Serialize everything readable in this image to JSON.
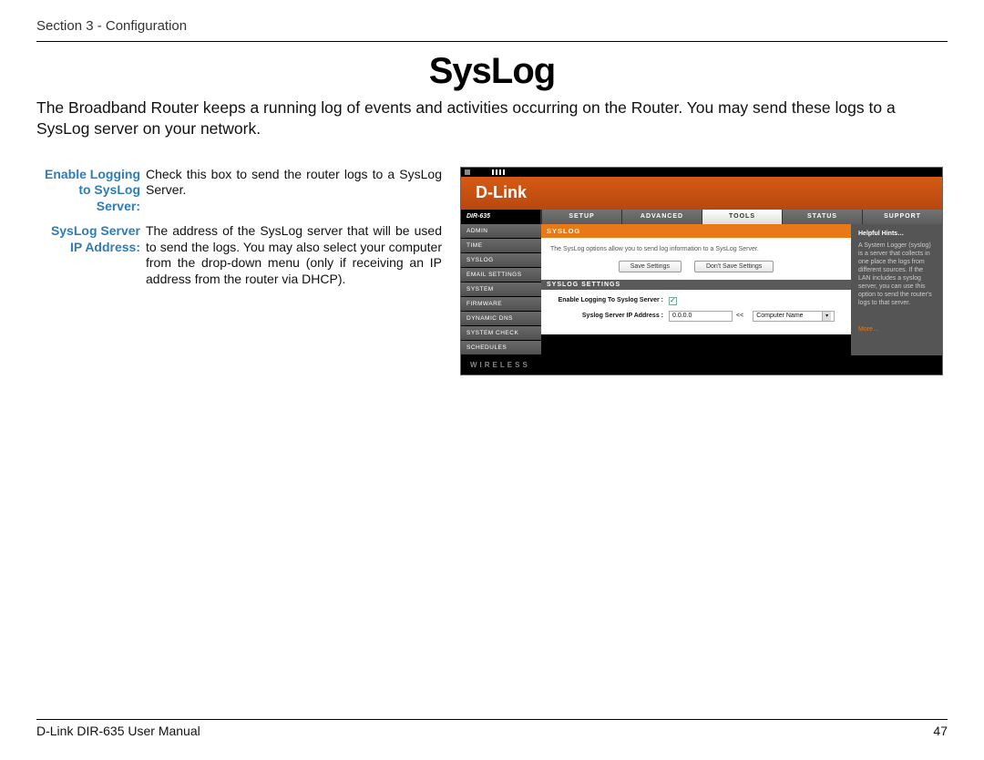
{
  "header": {
    "section": "Section 3 - Configuration"
  },
  "title": "SysLog",
  "intro": "The Broadband Router keeps a running log of events and activities occurring on the Router. You may send these logs to a SysLog server on your network.",
  "definitions": [
    {
      "term": "Enable Logging to SysLog Server:",
      "desc": "Check this box to send the router logs to a SysLog Server."
    },
    {
      "term": "SysLog Server IP Address:",
      "desc": "The address of the SysLog server that will be used to send the logs. You may also select your computer from the drop-down menu (only if receiving an IP address from the router via DHCP)."
    }
  ],
  "router": {
    "brand": "D-Link",
    "model": "DIR-635",
    "tabs": [
      "SETUP",
      "ADVANCED",
      "TOOLS",
      "STATUS",
      "SUPPORT"
    ],
    "active_tab_index": 2,
    "sidebar": [
      "ADMIN",
      "TIME",
      "SYSLOG",
      "EMAIL SETTINGS",
      "SYSTEM",
      "FIRMWARE",
      "DYNAMIC DNS",
      "SYSTEM CHECK",
      "SCHEDULES"
    ],
    "panel_title": "SYSLOG",
    "panel_desc": "The SysLog options allow you to send log information to a SysLog Server.",
    "buttons": {
      "save": "Save Settings",
      "dont": "Don't Save Settings"
    },
    "section_title": "SYSLOG SETTINGS",
    "settings": {
      "enable_label": "Enable Logging To Syslog Server :",
      "ip_label": "Syslog Server IP Address :",
      "ip_value": "0.0.0.0",
      "separator": "<<",
      "select_value": "Computer Name"
    },
    "hints": {
      "title": "Helpful Hints…",
      "body": "A System Logger (syslog) is a server that collects in one place the logs from different sources. If the LAN includes a syslog server, you can use this option to send the router's logs to that server.",
      "more": "More…"
    },
    "footer": "WIRELESS"
  },
  "footer": {
    "left": "D-Link DIR-635 User Manual",
    "right": "47"
  }
}
